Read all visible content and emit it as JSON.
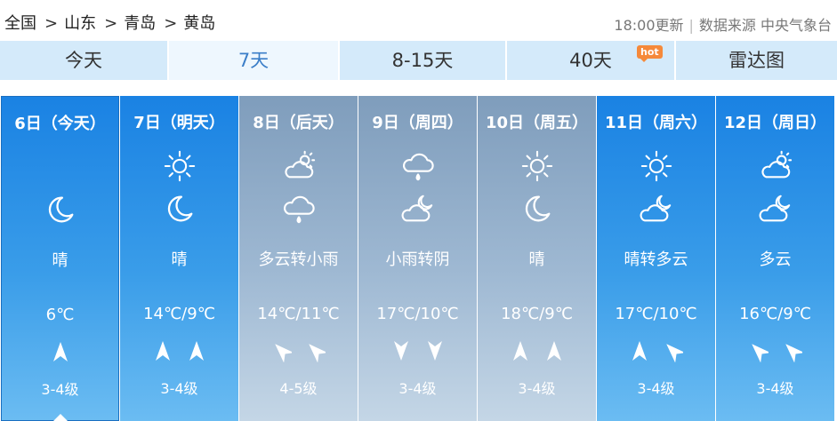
{
  "breadcrumb": [
    "全国",
    "山东",
    "青岛",
    "黄岛"
  ],
  "breadcrumb_sep": ">",
  "source": {
    "update": "18:00更新",
    "label": "数据来源 中央气象台"
  },
  "tabs": [
    {
      "label": "今天",
      "active": false
    },
    {
      "label": "7天",
      "active": true
    },
    {
      "label": "8-15天",
      "active": false
    },
    {
      "label": "40天",
      "active": false,
      "badge": "hot"
    },
    {
      "label": "雷达图",
      "active": false
    }
  ],
  "colors": {
    "blue_card": "#1a82e3",
    "grey_card": "#8aa5c3",
    "active_tab_text": "#3b7ec8",
    "hot_badge": "#f5893a"
  },
  "days": [
    {
      "date": "6日（今天）",
      "day_icon": "",
      "night_icon": "moon-icon",
      "weather": "晴",
      "temp": "6℃",
      "winds": [
        "north-icon"
      ],
      "wind_level": "3-4级",
      "style": "blue",
      "today": true
    },
    {
      "date": "7日（明天）",
      "day_icon": "sun-icon",
      "night_icon": "moon-icon",
      "weather": "晴",
      "temp": "14℃/9℃",
      "winds": [
        "north-icon",
        "north-icon"
      ],
      "wind_level": "3-4级",
      "style": "blue",
      "today": false
    },
    {
      "date": "8日（后天）",
      "day_icon": "cloud-sun-icon",
      "night_icon": "light-rain-icon",
      "weather": "多云转小雨",
      "temp": "14℃/11℃",
      "winds": [
        "northwest-icon",
        "northwest-icon"
      ],
      "wind_level": "4-5级",
      "style": "grey",
      "today": false
    },
    {
      "date": "9日（周四）",
      "day_icon": "light-rain-icon",
      "night_icon": "cloud-moon-icon",
      "weather": "小雨转阴",
      "temp": "17℃/10℃",
      "winds": [
        "south-icon",
        "south-icon"
      ],
      "wind_level": "3-4级",
      "style": "grey",
      "today": false
    },
    {
      "date": "10日（周五）",
      "day_icon": "sun-icon",
      "night_icon": "moon-icon",
      "weather": "晴",
      "temp": "18℃/9℃",
      "winds": [
        "north-icon",
        "north-icon"
      ],
      "wind_level": "3-4级",
      "style": "grey",
      "today": false
    },
    {
      "date": "11日（周六）",
      "day_icon": "sun-icon",
      "night_icon": "cloud-moon-icon",
      "weather": "晴转多云",
      "temp": "17℃/10℃",
      "winds": [
        "north-icon",
        "northwest-icon"
      ],
      "wind_level": "3-4级",
      "style": "blue",
      "today": false
    },
    {
      "date": "12日（周日）",
      "day_icon": "cloud-sun-icon",
      "night_icon": "cloud-moon-icon",
      "weather": "多云",
      "temp": "16℃/9℃",
      "winds": [
        "northwest-icon",
        "northwest-icon"
      ],
      "wind_level": "3-4级",
      "style": "blue",
      "today": false
    }
  ]
}
